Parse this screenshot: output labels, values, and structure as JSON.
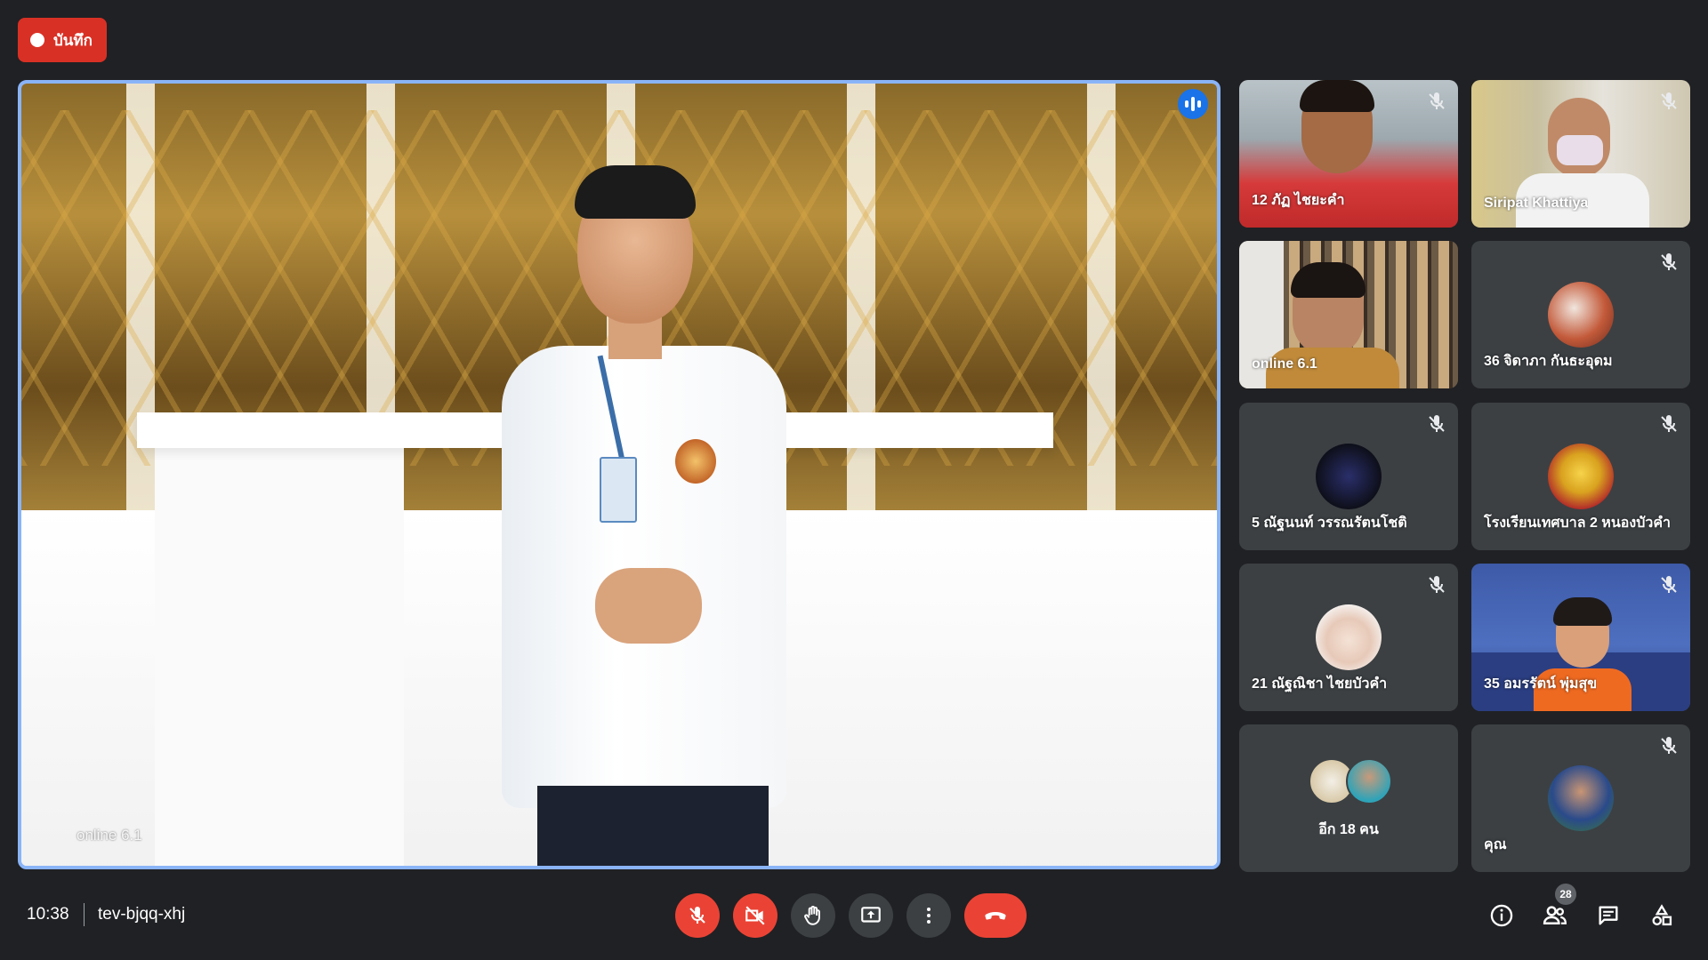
{
  "recording": {
    "label": "บันทึก"
  },
  "main_tile": {
    "name": "online 6.1"
  },
  "participants": [
    {
      "name": "12 ภัฏ ไชยะคำ",
      "muted": true
    },
    {
      "name": "Siripat Khattiya",
      "muted": true
    },
    {
      "name": "online 6.1",
      "muted": false
    },
    {
      "name": "36 จิดาภา กันธะอุดม",
      "muted": true
    },
    {
      "name": "5 ณัฐนนท์ วรรณรัตนโชติ",
      "muted": true
    },
    {
      "name": "โรงเรียนเทศบาล 2 หนองบัวคำ",
      "muted": true
    },
    {
      "name": "21 ณัฐณิชา ไชยบัวคำ",
      "muted": true
    },
    {
      "name": "35 อมรรัตน์ พุ่มสุข",
      "muted": true
    },
    {
      "name": "อีก 18 คน",
      "muted": false
    },
    {
      "name": "คุณ",
      "muted": true
    }
  ],
  "bottom_bar": {
    "time": "10:38",
    "meeting_code": "tev-bjqq-xhj",
    "participant_count": "28"
  },
  "colors": {
    "background": "#202124",
    "tile": "#3c4043",
    "accent_blue": "#8ab4f8",
    "danger_red": "#ea4335",
    "record_red": "#d93025"
  },
  "icons": {
    "mic": "mic-off-icon",
    "camera": "videocam-off-icon",
    "hand": "raise-hand-icon",
    "present": "present-screen-icon",
    "more": "more-vert-icon",
    "hangup": "call-end-icon",
    "info": "info-icon",
    "people": "people-icon",
    "chat": "chat-icon",
    "activities": "activities-icon"
  }
}
